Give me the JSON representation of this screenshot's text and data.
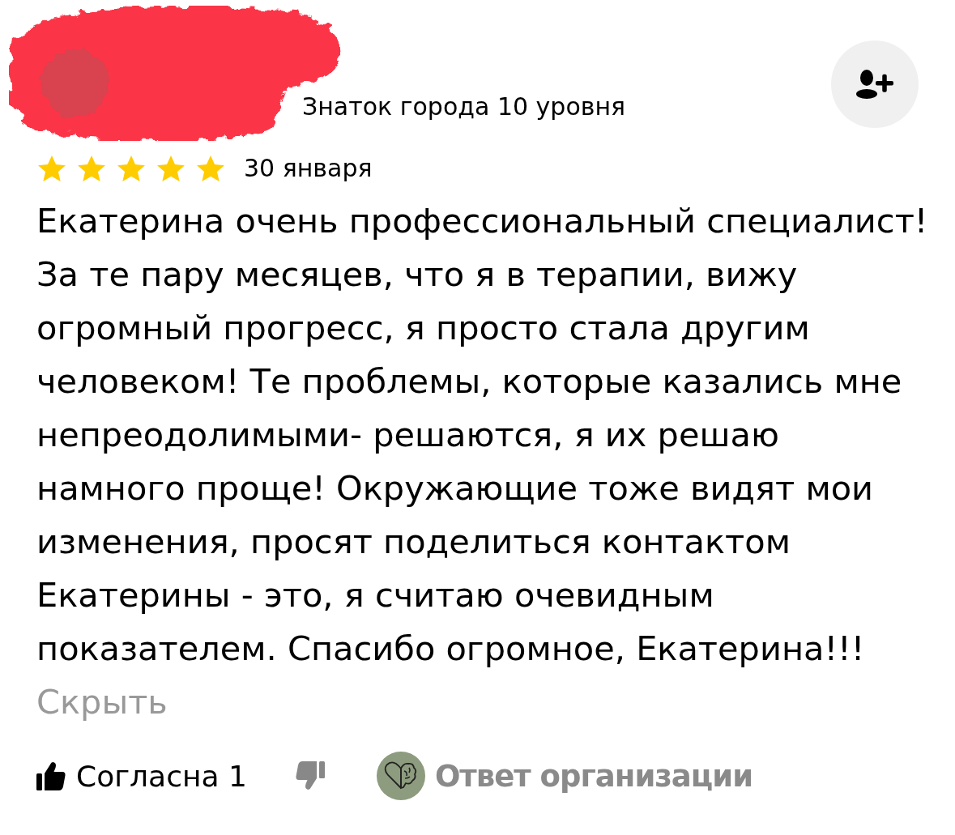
{
  "author": {
    "level": "Знаток города 10 уровня"
  },
  "review": {
    "stars": 5,
    "date": "30 января",
    "text": "Екатерина очень профессиональный специалист! За те пару месяцев, что я в терапии, вижу огромный прогресс, я просто стала другим человеком! Те проблемы, которые казались мне непреодолимыми- решаются, я их решаю намного проще! Окружающие тоже видят мои изменения, просят поделиться контактом Екатерины - это, я считаю очевидным показателем. Спасибо огромное, Екатерина!!!",
    "toggle": "Скрыть"
  },
  "actions": {
    "like": {
      "label": "Согласна 1"
    },
    "org_reply": {
      "label": "Ответ организации"
    }
  }
}
